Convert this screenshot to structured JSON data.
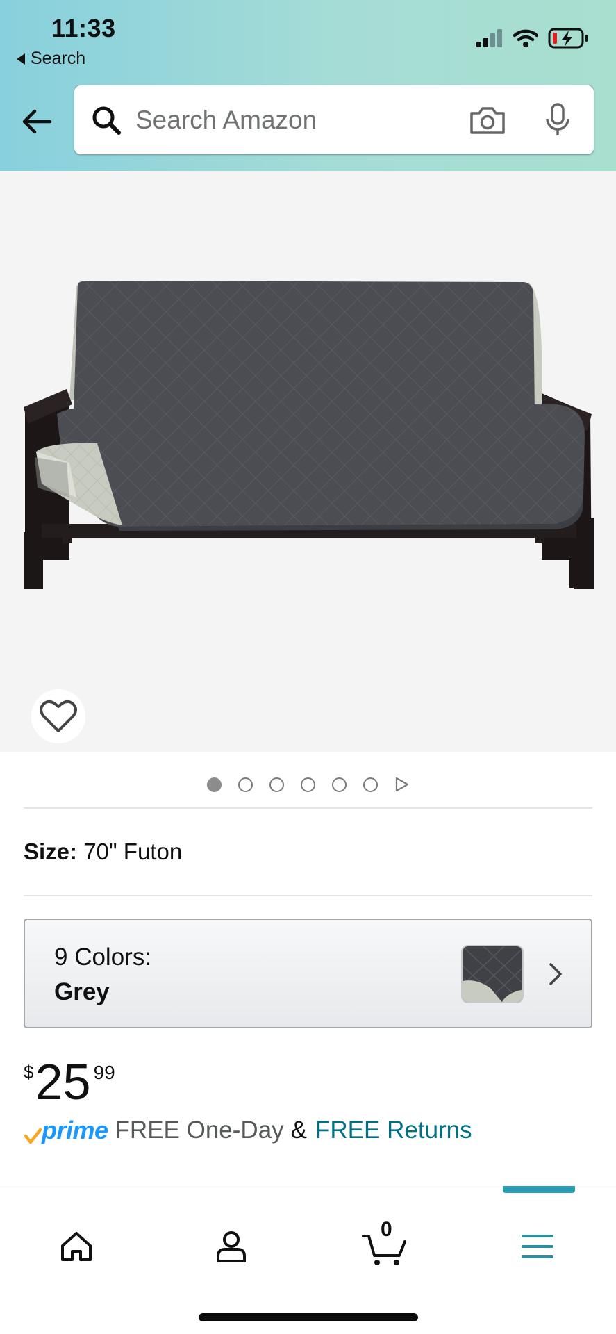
{
  "status_bar": {
    "time": "11:33",
    "back_app_label": "Search"
  },
  "header": {
    "search_placeholder": "Search Amazon"
  },
  "product": {
    "image_dots": {
      "count": 6,
      "active_index": 0
    },
    "size_label": "Size:",
    "size_value": "70\" Futon",
    "colors_label": "9 Colors:",
    "color_selected": "Grey",
    "price_symbol": "$",
    "price_whole": "25",
    "price_fraction": "99",
    "prime_label": "prime",
    "delivery_text": "FREE One-Day",
    "ampersand": "&",
    "returns_text": "FREE Returns"
  },
  "bottom_nav": {
    "items": [
      "home-icon",
      "account-icon",
      "cart-icon",
      "menu-icon"
    ],
    "cart_count": "0",
    "active": "menu"
  },
  "colors": {
    "header_gradient_start": "#88d0dd",
    "header_gradient_end": "#a9dfcf",
    "link_teal": "#007185",
    "prime_blue": "#1a98ff",
    "prime_check_orange": "#f7a823",
    "nav_active": "#2a9bb0"
  }
}
